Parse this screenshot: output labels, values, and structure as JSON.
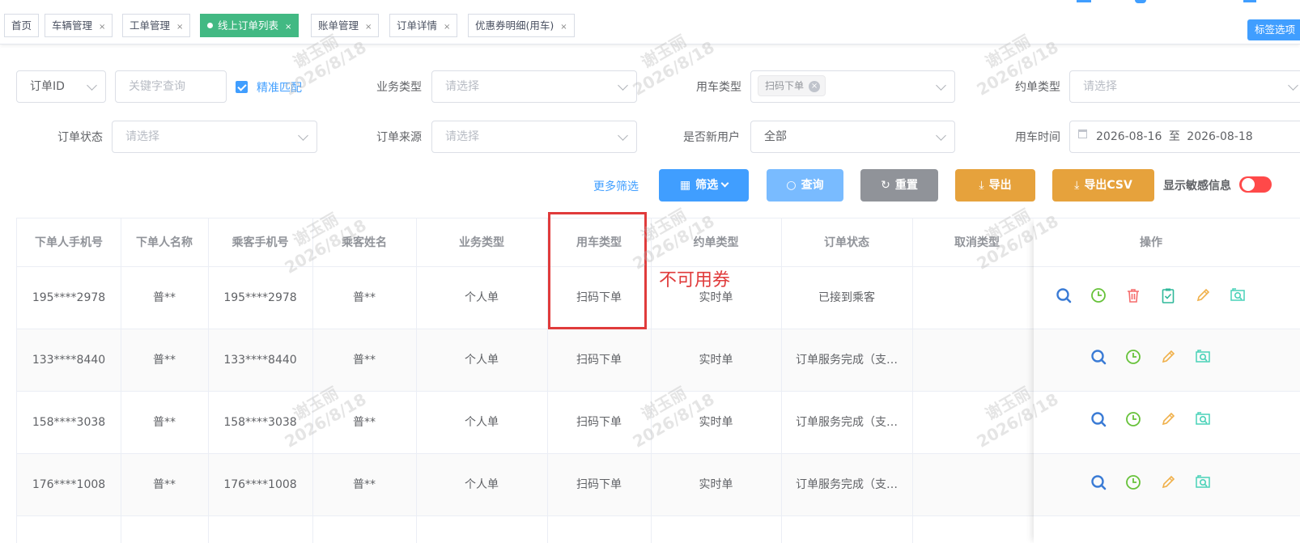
{
  "tabs": [
    {
      "label": "首页",
      "closable": false,
      "active": false
    },
    {
      "label": "车辆管理",
      "closable": true,
      "active": false
    },
    {
      "label": "工单管理",
      "closable": true,
      "active": false
    },
    {
      "label": "线上订单列表",
      "closable": true,
      "active": true
    },
    {
      "label": "账单管理",
      "closable": true,
      "active": false
    },
    {
      "label": "订单详情",
      "closable": true,
      "active": false
    },
    {
      "label": "优惠券明细(用车)",
      "closable": true,
      "active": false
    }
  ],
  "close_glyph": "×",
  "tag_options_label": "标签选项",
  "filters": {
    "id_select": "订单ID",
    "keyword_placeholder": "关键字查询",
    "exact_match_label": "精准匹配",
    "business_type_label": "业务类型",
    "business_type_placeholder": "请选择",
    "car_type_label": "用车类型",
    "car_type_chip": "扫码下单",
    "appointment_type_label": "约单类型",
    "appointment_type_placeholder": "请选择",
    "order_status_label": "订单状态",
    "order_status_placeholder": "请选择",
    "order_source_label": "订单来源",
    "order_source_placeholder": "请选择",
    "new_user_label": "是否新用户",
    "new_user_value": "全部",
    "time_label": "用车时间",
    "date_start": "2026-08-16",
    "date_sep": "至",
    "date_end": "2026-08-18"
  },
  "actions": {
    "more_filters": "更多筛选",
    "filter": "筛选",
    "query": "查询",
    "reset": "重置",
    "export": "导出",
    "export_csv": "导出CSV",
    "show_sensitive": "显示敏感信息"
  },
  "colors": {
    "primary": "#409eff",
    "query": "#66b1ff",
    "reset": "#909399",
    "export": "#e6a23c",
    "active_tag": "#42b983",
    "annotation": "#e03b3b"
  },
  "table": {
    "columns": [
      "下单人手机号",
      "下单人名称",
      "乘客手机号",
      "乘客姓名",
      "业务类型",
      "用车类型",
      "约单类型",
      "订单状态",
      "取消类型",
      "操作"
    ],
    "rows": [
      [
        "195****2978",
        "普**",
        "195****2978",
        "普**",
        "个人单",
        "扫码下单",
        "实时单",
        "已接到乘客",
        ""
      ],
      [
        "133****8440",
        "普**",
        "133****8440",
        "普**",
        "个人单",
        "扫码下单",
        "实时单",
        "订单服务完成（支…",
        ""
      ],
      [
        "158****3038",
        "普**",
        "158****3038",
        "普**",
        "个人单",
        "扫码下单",
        "实时单",
        "订单服务完成（支…",
        ""
      ],
      [
        "176****1008",
        "普**",
        "176****1008",
        "普**",
        "个人单",
        "扫码下单",
        "实时单",
        "订单服务完成（支…",
        ""
      ]
    ],
    "row_actions": [
      [
        "search-icon",
        "clock-icon",
        "delete-icon",
        "clipboard-check-icon",
        "edit-icon",
        "image-search-icon"
      ],
      [
        "search-icon",
        "clock-icon",
        "edit-icon",
        "image-search-icon"
      ],
      [
        "search-icon",
        "clock-icon",
        "edit-icon",
        "image-search-icon"
      ],
      [
        "search-icon",
        "clock-icon",
        "edit-icon",
        "image-search-icon"
      ]
    ]
  },
  "annotation": "不可用券",
  "watermark": {
    "name": "谢玉丽",
    "date": "2026/8/18"
  }
}
